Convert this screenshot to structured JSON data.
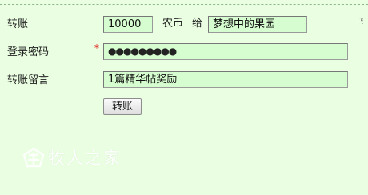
{
  "form": {
    "transfer": {
      "label": "转账",
      "amount": "10000",
      "currency_unit": "农币",
      "to_word": "给",
      "recipient": "梦想中的果园"
    },
    "password": {
      "label": "登录密码",
      "required_mark": "*",
      "masked_value": "●●●●●●●●●"
    },
    "message": {
      "label": "转账留言",
      "value": "1篇精华帖奖励"
    },
    "submit_label": "转账"
  },
  "edge_fragment": "写",
  "watermark": {
    "text": "牧人之家",
    "icon": "logo-mark-icon"
  },
  "colors": {
    "background": "#eaffe1",
    "field_background": "#d6fdcf",
    "required": "#e00000"
  }
}
